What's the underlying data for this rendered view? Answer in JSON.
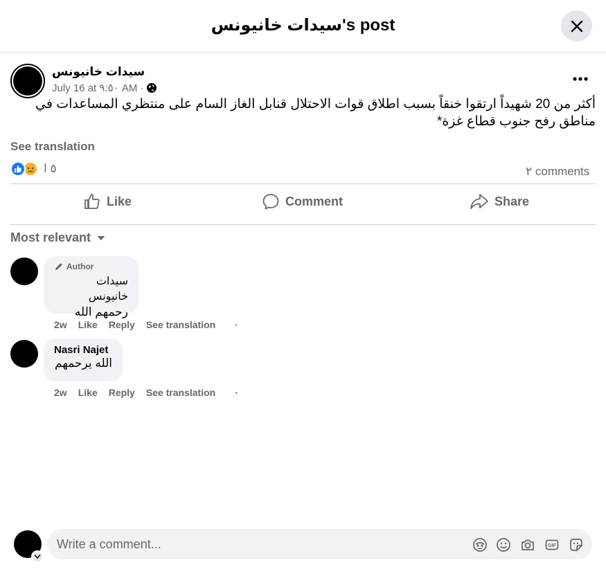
{
  "header": {
    "title": "سيدات خانيونس's post"
  },
  "post": {
    "author": "سيدات خانيونس",
    "timestamp": "July 16 at ٩:٥٠ AM",
    "separator": "·",
    "privacy_icon": "globe-icon",
    "text": "أكثر من 20 شهيداً ارتقوا خنقاً بسبب اطلاق قوات الاحتلال قنابل الغاز السام على منتظري المساعدات في مناطق رفح جنوب قطاع غزة*",
    "see_translation": "See translation",
    "reactions": {
      "icons": [
        "like-icon",
        "sad-icon"
      ],
      "count": "٥ ا"
    },
    "comments_count": "٢ comments"
  },
  "actions": {
    "like": "Like",
    "comment": "Comment",
    "share": "Share"
  },
  "sort": {
    "label": "Most relevant"
  },
  "comments": [
    {
      "badge": "Author",
      "name": "سيدات خانيونس",
      "text": "رحمهم الله",
      "time": "2w",
      "like": "Like",
      "reply": "Reply",
      "see_translation": "See translation",
      "dot": "·"
    },
    {
      "name": "Nasri Najet",
      "text": "الله يرحمهم",
      "time": "2w",
      "like": "Like",
      "reply": "Reply",
      "see_translation": "See translation",
      "dot": "·"
    }
  ],
  "composer": {
    "placeholder": "Write a comment...",
    "icons": [
      "avatar-sticker-icon",
      "emoji-icon",
      "camera-icon",
      "gif-icon",
      "sticker-icon"
    ]
  },
  "colors": {
    "accent": "#1877f2",
    "secondary_text": "#65676b",
    "surface": "#f0f2f5"
  }
}
